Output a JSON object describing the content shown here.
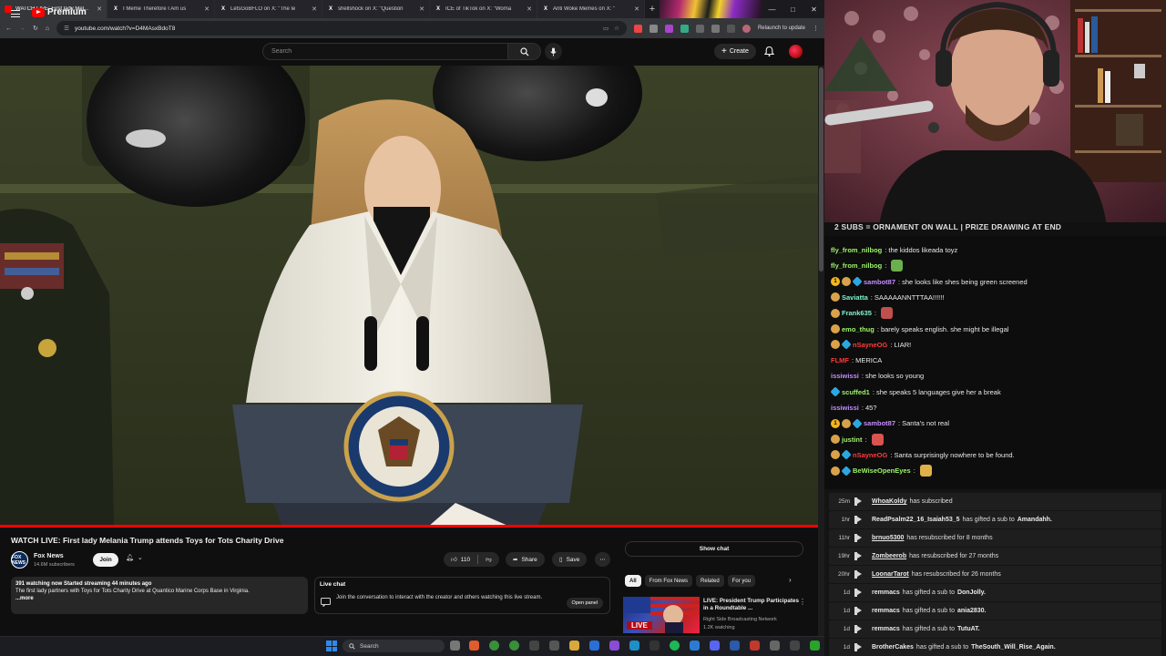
{
  "browser": {
    "tabs": [
      {
        "title": "WATCH LIVE: First lady Mel...",
        "icon": "youtube-icon",
        "color": "#ff0000",
        "active": true
      },
      {
        "title": "I Meme Therefore I Am us",
        "icon": "x-logo-icon",
        "color": "#ffffff",
        "active": false
      },
      {
        "title": "LetsGoBFLO on X: \"The le",
        "icon": "x-logo-icon",
        "color": "#ffffff",
        "active": false
      },
      {
        "title": "shellshock on X: \"Question",
        "icon": "x-logo-icon",
        "color": "#ffffff",
        "active": false
      },
      {
        "title": "ICE of TikTok on X: \"Woma",
        "icon": "x-logo-icon",
        "color": "#ffffff",
        "active": false
      },
      {
        "title": "Anti Woke Memes on X: \"",
        "icon": "x-logo-icon",
        "color": "#ffffff",
        "active": false
      }
    ],
    "url": "youtube.com/watch?v=D4MAsxBdoT8",
    "relaunch": "Relaunch to update"
  },
  "youtube": {
    "logo_text": "Premium",
    "search_placeholder": "Search",
    "create_label": "Create",
    "video": {
      "title": "WATCH LIVE: First lady Melania Trump attends Toys for Tots Charity Drive",
      "progress": 1.0
    },
    "channel": {
      "name": "Fox News",
      "avatar_text": "FOX NEWS",
      "subscribers": "14.6M subscribers",
      "join_label": "Join"
    },
    "actions": {
      "likes": "110",
      "share": "Share",
      "save": "Save",
      "show_chat": "Show chat"
    },
    "description": {
      "stats": "391 watching now  Started streaming 44 minutes ago",
      "text": "The first lady partners with Toys for Tots Charity Drive at Quantico Marine Corps Base in Virginia.",
      "more": "...more"
    },
    "live_chat": {
      "title": "Live chat",
      "body": "Join the conversation to interact with the creator and others watching this live stream.",
      "open_panel": "Open panel"
    },
    "chips": [
      "All",
      "From Fox News",
      "Related",
      "For you"
    ],
    "recommended": {
      "badge": "LIVE",
      "title": "LIVE: President Trump Participates in a Roundtable ...",
      "channel": "Right Side Broadcasting Network",
      "views": "1.2K watching"
    }
  },
  "stream_overlay": {
    "banner": "2 SUBS = ORNAMENT ON WALL | PRIZE DRAWING AT END",
    "chat": [
      {
        "badges": [],
        "user": "fly_from_nilbog",
        "color": "#9ff36a",
        "text": "the kiddos likeada toyz",
        "emote": null
      },
      {
        "badges": [],
        "user": "fly_from_nilbog",
        "color": "#9ff36a",
        "text": "",
        "emote": "#6ab04c"
      },
      {
        "badges": [
          "gold",
          "tan",
          "blue"
        ],
        "user": "sambot87",
        "color": "#c58cff",
        "text": "she looks like shes being green screened",
        "emote": null
      },
      {
        "badges": [
          "tan"
        ],
        "user": "Saviatta",
        "color": "#7ef5d0",
        "text": "SAAAAANNTTTAA!!!!!!",
        "emote": null
      },
      {
        "badges": [
          "tan"
        ],
        "user": "Frank635",
        "color": "#7ef5d0",
        "text": "",
        "emote": "#c0504d"
      },
      {
        "badges": [
          "tan"
        ],
        "user": "emo_thug",
        "color": "#9ff36a",
        "text": "barely speaks english. she might be illegal",
        "emote": null
      },
      {
        "badges": [
          "tan",
          "blue"
        ],
        "user": "nSayneOG",
        "color": "#ff3b3b",
        "text": "LIAR!",
        "emote": null
      },
      {
        "badges": [],
        "user": "FLMF",
        "color": "#ff3b3b",
        "text": "MERICA",
        "emote": null
      },
      {
        "badges": [],
        "user": "issiwissi",
        "color": "#c58cff",
        "text": "she looks so young",
        "emote": null
      },
      {
        "badges": [
          "blue"
        ],
        "user": "scuffed1",
        "color": "#9ff36a",
        "text": "she speaks 5 languages give her a break",
        "emote": null
      },
      {
        "badges": [],
        "user": "issiwissi",
        "color": "#c58cff",
        "text": "45?",
        "emote": null
      },
      {
        "badges": [
          "gold",
          "tan",
          "blue"
        ],
        "user": "sambot87",
        "color": "#c58cff",
        "text": "Santa's not real",
        "emote": null
      },
      {
        "badges": [
          "tan"
        ],
        "user": "justint",
        "color": "#9ff36a",
        "text": "",
        "emote": "#d9534f"
      },
      {
        "badges": [
          "tan",
          "blue"
        ],
        "user": "nSayneOG",
        "color": "#ff3b3b",
        "text": "Santa surprisingly nowhere to be found.",
        "emote": null
      },
      {
        "badges": [
          "tan",
          "blue"
        ],
        "user": "BeWiseOpenEyes",
        "color": "#9ff36a",
        "text": "",
        "emote": "#e0b04a"
      }
    ],
    "events": [
      {
        "time": "25m",
        "user": "WhoaKoldy",
        "underline": true,
        "action": "has subscribed",
        "recipient": ""
      },
      {
        "time": "1hr",
        "user": "ReadPsalm22_16_Isaiah53_5",
        "underline": false,
        "action": "has gifted a sub to",
        "recipient": "Amandahh."
      },
      {
        "time": "11hr",
        "user": "brnuo5300",
        "underline": true,
        "action": "has resubscribed for 8 months",
        "recipient": ""
      },
      {
        "time": "19hr",
        "user": "Zombeerob",
        "underline": true,
        "action": "has resubscribed for 27 months",
        "recipient": ""
      },
      {
        "time": "20hr",
        "user": "LoonarTarot",
        "underline": true,
        "action": "has resubscribed for 26 months",
        "recipient": ""
      },
      {
        "time": "1d",
        "user": "remmacs",
        "underline": false,
        "action": "has gifted a sub to",
        "recipient": "DonJolly."
      },
      {
        "time": "1d",
        "user": "remmacs",
        "underline": false,
        "action": "has gifted a sub to",
        "recipient": "ania2830."
      },
      {
        "time": "1d",
        "user": "remmacs",
        "underline": false,
        "action": "has gifted a sub to",
        "recipient": "TutuAT."
      },
      {
        "time": "1d",
        "user": "BrotherCakes",
        "underline": false,
        "action": "has gifted a sub to",
        "recipient": "TheSouth_Will_Rise_Again."
      }
    ]
  },
  "taskbar": {
    "search": "Search"
  },
  "colors": {
    "yt_red": "#ff0000",
    "background": "#0f0f0f",
    "chip_active": "#f1f1f1"
  }
}
